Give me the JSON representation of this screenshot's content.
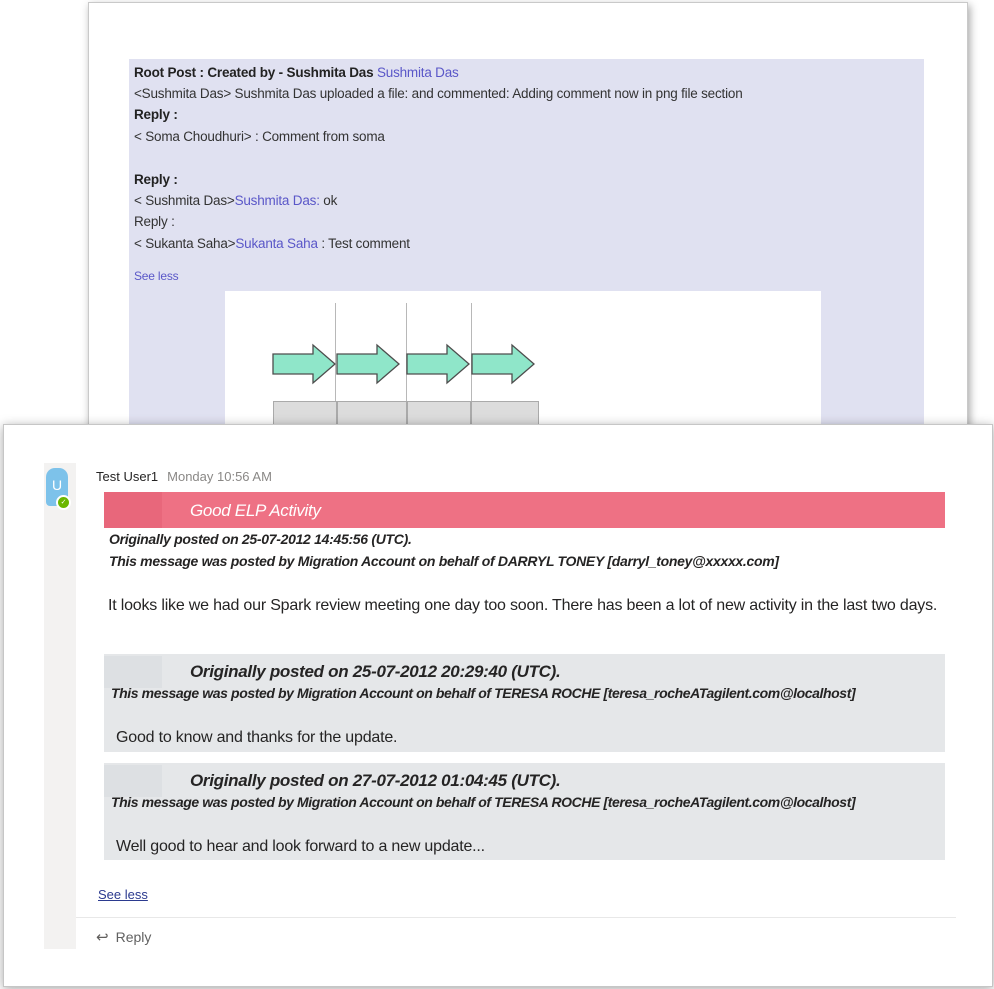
{
  "top_card": {
    "lines": [
      {
        "prefix": "Root Post : Created by - Sushmita Das ",
        "link": "Sushmita Das",
        "suffix": ""
      },
      {
        "prefix": " <Sushmita Das> Sushmita Das uploaded a file: and commented: Adding comment now in png file section",
        "link": "",
        "suffix": ""
      },
      {
        "prefix": " Reply :",
        "link": "",
        "suffix": ""
      },
      {
        "prefix": "< Soma Choudhuri> : Comment from soma",
        "link": "",
        "suffix": ""
      },
      {
        "prefix": "Reply :",
        "link": "",
        "suffix": ""
      },
      {
        "prefix": "< Sushmita Das>",
        "link": "Sushmita Das:",
        "suffix": "  ok"
      },
      {
        "prefix": "Reply :",
        "link": "",
        "suffix": ""
      },
      {
        "prefix": "< Sukanta Saha>",
        "link": "Sukanta Saha",
        "suffix": " : Test comment"
      }
    ],
    "see_less": "See less"
  },
  "message": {
    "author": "Test User1",
    "timestamp": "Monday 10:56 AM",
    "avatar_initial": "U",
    "banner_title": "Good ELP Activity",
    "originally_posted": "Originally posted on 25-07-2012 14:45:56 (UTC).",
    "posted_by": "This message was posted by Migration Account on behalf of DARRYL TONEY [darryl_toney@xxxxx.com]",
    "body": "It looks like we had our Spark review meeting one day too soon. There has been a lot of new activity in the last two days.",
    "replies": [
      {
        "originally_posted": "Originally posted on 25-07-2012 20:29:40 (UTC).",
        "posted_by": "This message was posted by Migration Account on behalf of TERESA ROCHE [teresa_rocheATagilent.com@localhost]",
        "text": "Good to know and thanks for the update."
      },
      {
        "originally_posted": "Originally posted on 27-07-2012 01:04:45 (UTC).",
        "posted_by": "This message was posted by Migration Account on behalf of TERESA ROCHE [teresa_rocheATagilent.com@localhost]",
        "text": "Well good to hear and look forward to a new update..."
      }
    ],
    "see_less": "See less",
    "reply_label": "Reply"
  },
  "colors": {
    "banner": "#ee7184",
    "quote_bg": "#e5e7e9",
    "thread_bg": "#e0e1f1",
    "link": "#5a57c8",
    "avatar": "#7dc2ea",
    "presence": "#6bb700"
  },
  "icons": [
    "arrow-shape-icon",
    "reply-arrow-icon",
    "presence-check-icon"
  ]
}
